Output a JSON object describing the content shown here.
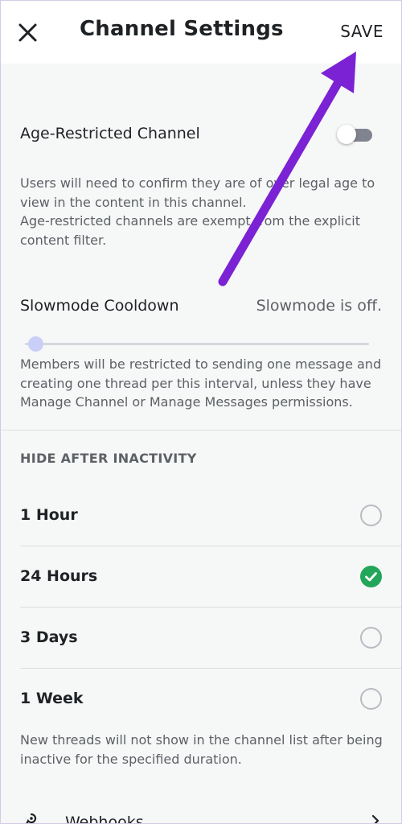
{
  "header": {
    "title": "Channel Settings",
    "save_label": "SAVE",
    "close_icon": "close-icon"
  },
  "age_restricted": {
    "label": "Age-Restricted Channel",
    "enabled": false,
    "description_line1": "Users will need to confirm they are of over legal age to view in the content in this channel.",
    "description_line2": "Age-restricted channels are exempt from the explicit content filter."
  },
  "slowmode": {
    "label": "Slowmode Cooldown",
    "value": "Slowmode is off.",
    "slider_fraction": 0,
    "description": "Members will be restricted to sending one message and creating one thread per this interval, unless they have Manage Channel or Manage Messages permissions."
  },
  "hide_after_inactivity": {
    "header": "HIDE AFTER INACTIVITY",
    "options": [
      {
        "label": "1 Hour",
        "selected": false
      },
      {
        "label": "24 Hours",
        "selected": true
      },
      {
        "label": "3 Days",
        "selected": false
      },
      {
        "label": "1 Week",
        "selected": false
      }
    ],
    "description": "New threads will not show in the channel list after being inactive for the specified duration."
  },
  "webhooks": {
    "label": "Webhooks",
    "icon": "webhook-icon"
  },
  "colors": {
    "accent_annotation": "#7b22d4",
    "check_green": "#23a55a",
    "slider_thumb": "#c9cff7"
  }
}
